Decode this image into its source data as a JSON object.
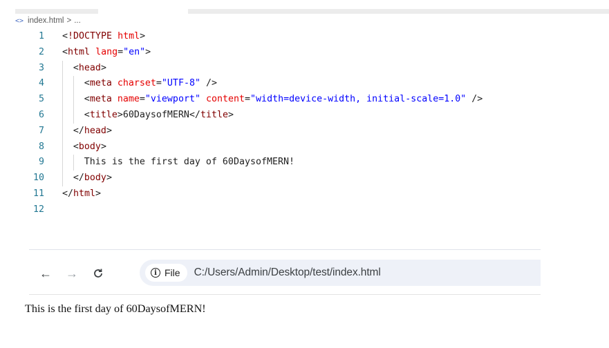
{
  "breadcrumb": {
    "icon": "code-icon",
    "file": "index.html",
    "separator": ">",
    "more": "..."
  },
  "editor": {
    "lines": [
      {
        "n": "1",
        "tokens": [
          [
            "p",
            "<"
          ],
          [
            "t",
            "!DOCTYPE"
          ],
          [
            "p",
            " "
          ],
          [
            "a",
            "html"
          ],
          [
            "p",
            ">"
          ]
        ]
      },
      {
        "n": "2",
        "tokens": [
          [
            "p",
            "<"
          ],
          [
            "t",
            "html"
          ],
          [
            "p",
            " "
          ],
          [
            "a",
            "lang"
          ],
          [
            "p",
            "="
          ],
          [
            "v",
            "\"en\""
          ],
          [
            "p",
            ">"
          ]
        ]
      },
      {
        "n": "3",
        "tokens": [
          [
            "p",
            "<"
          ],
          [
            "t",
            "head"
          ],
          [
            "p",
            ">"
          ]
        ]
      },
      {
        "n": "4",
        "tokens": [
          [
            "p",
            "<"
          ],
          [
            "t",
            "meta"
          ],
          [
            "p",
            " "
          ],
          [
            "a",
            "charset"
          ],
          [
            "p",
            "="
          ],
          [
            "v",
            "\"UTF-8\""
          ],
          [
            "p",
            " />"
          ]
        ]
      },
      {
        "n": "5",
        "tokens": [
          [
            "p",
            "<"
          ],
          [
            "t",
            "meta"
          ],
          [
            "p",
            " "
          ],
          [
            "a",
            "name"
          ],
          [
            "p",
            "="
          ],
          [
            "v",
            "\"viewport\""
          ],
          [
            "p",
            " "
          ],
          [
            "a",
            "content"
          ],
          [
            "p",
            "="
          ],
          [
            "v",
            "\"width=device-width, initial-scale=1.0\""
          ],
          [
            "p",
            " />"
          ]
        ]
      },
      {
        "n": "6",
        "tokens": [
          [
            "p",
            "<"
          ],
          [
            "t",
            "title"
          ],
          [
            "p",
            ">60DaysofMERN</"
          ],
          [
            "t",
            "title"
          ],
          [
            "p",
            ">"
          ]
        ]
      },
      {
        "n": "7",
        "tokens": [
          [
            "p",
            "</"
          ],
          [
            "t",
            "head"
          ],
          [
            "p",
            ">"
          ]
        ]
      },
      {
        "n": "8",
        "tokens": [
          [
            "p",
            "<"
          ],
          [
            "t",
            "body"
          ],
          [
            "p",
            ">"
          ]
        ]
      },
      {
        "n": "9",
        "tokens": [
          [
            "p",
            "This is the first day of 60DaysofMERN!"
          ]
        ]
      },
      {
        "n": "10",
        "tokens": [
          [
            "p",
            "</"
          ],
          [
            "t",
            "body"
          ],
          [
            "p",
            ">"
          ]
        ]
      },
      {
        "n": "11",
        "tokens": [
          [
            "p",
            "</"
          ],
          [
            "t",
            "html"
          ],
          [
            "p",
            ">"
          ]
        ]
      },
      {
        "n": "12",
        "tokens": []
      }
    ]
  },
  "browser": {
    "back_icon": "back-arrow-icon",
    "forward_icon": "forward-arrow-icon",
    "reload_icon": "reload-icon",
    "site_info_icon": "info-icon",
    "site_chip_label": "File",
    "url": "C:/Users/Admin/Desktop/test/index.html"
  },
  "page": {
    "body_text": "This is the first day of 60DaysofMERN!"
  }
}
